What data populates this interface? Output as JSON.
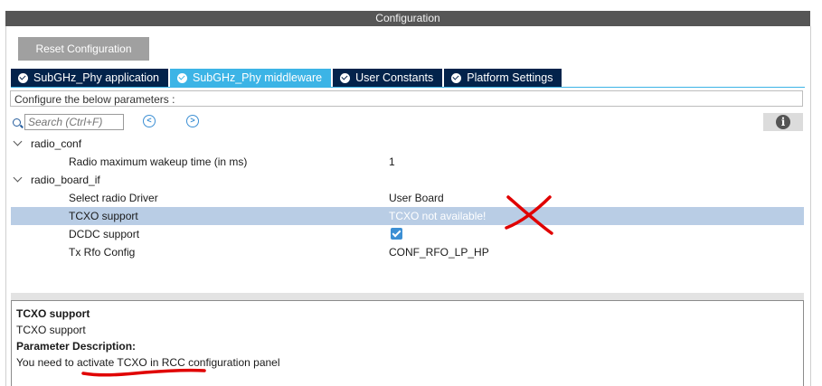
{
  "window": {
    "title": "Configuration"
  },
  "toolbar": {
    "reset_label": "Reset Configuration"
  },
  "tabs": [
    {
      "label": "SubGHz_Phy application",
      "active": false
    },
    {
      "label": "SubGHz_Phy middleware",
      "active": true
    },
    {
      "label": "User Constants",
      "active": false
    },
    {
      "label": "Platform Settings",
      "active": false
    }
  ],
  "params_header": "Configure the below parameters :",
  "search": {
    "placeholder": "Search (Ctrl+F)"
  },
  "nav": {
    "prev": "<",
    "next": ">"
  },
  "info": "i",
  "tree": {
    "radio_conf": {
      "label": "radio_conf",
      "wakeup": {
        "label": "Radio maximum wakeup time (in ms)",
        "value": "1"
      }
    },
    "radio_board_if": {
      "label": "radio_board_if",
      "driver": {
        "label": "Select radio Driver",
        "value": "User Board"
      },
      "tcxo": {
        "label": "TCXO support",
        "value": "TCXO not available!"
      },
      "dcdc": {
        "label": "DCDC support",
        "checked": true
      },
      "rfo": {
        "label": "Tx Rfo Config",
        "value": "CONF_RFO_LP_HP"
      }
    }
  },
  "description": {
    "title": "TCXO support",
    "name": "TCXO support",
    "heading": "Parameter Description:",
    "text": "You need to activate TCXO in RCC configuration panel"
  },
  "colors": {
    "tab_bg": "#03234b",
    "tab_active": "#3cb4e6",
    "selected_row": "#b9cde5",
    "annotation": "#e00000"
  }
}
